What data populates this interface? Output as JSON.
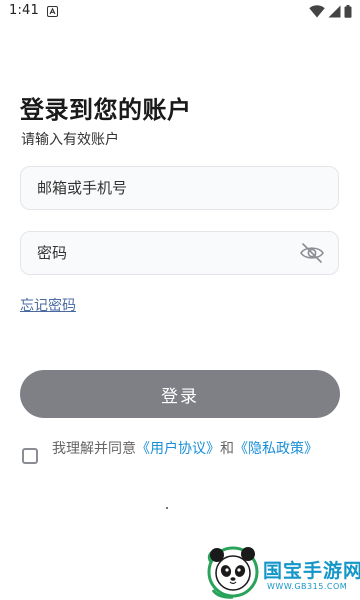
{
  "status_bar": {
    "time": "1:41",
    "icons": [
      "notification-a-icon",
      "wifi-icon",
      "cellular-signal-icon",
      "battery-icon"
    ]
  },
  "login": {
    "title": "登录到您的账户",
    "subtitle": "请输入有效账户",
    "email_placeholder": "邮箱或手机号",
    "password_placeholder": "密码",
    "password_toggle_icon": "eye-off-icon",
    "forgot_password": "忘记密码",
    "login_button": "登录"
  },
  "agreement": {
    "checked": false,
    "prefix": "我理解并同意",
    "user_agreement": "《用户协议》",
    "connector": "和",
    "privacy_policy": "《隐私政策》"
  },
  "watermark": {
    "name": "国宝手游网",
    "url": "WWW.GB315.COM"
  },
  "colors": {
    "button_bg": "#7e8086",
    "link": "#1a8fd8",
    "input_bg": "#f9fafb",
    "watermark": "#1596c8"
  }
}
